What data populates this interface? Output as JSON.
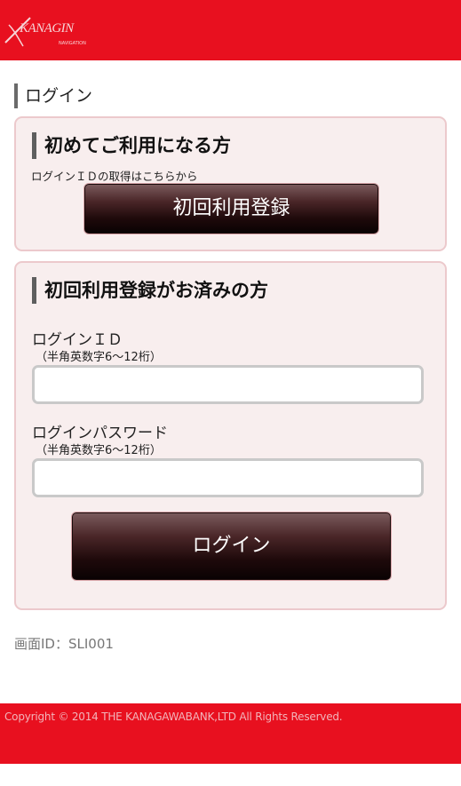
{
  "header": {
    "logo_text": "KANAGIN",
    "logo_subtext": "NAVIGATION",
    "background_color": "#e8101f"
  },
  "page_title": "ログイン",
  "first_time": {
    "heading": "初めてご利用になる方",
    "note": "ログインＩＤの取得はこちらから",
    "register_button": "初回利用登録"
  },
  "registered": {
    "heading": "初回利用登録がお済みの方",
    "login_id_label": "ログインＩＤ",
    "login_id_hint": "（半角英数字6～12桁）",
    "login_id_value": "",
    "password_label": "ログインパスワード",
    "password_hint": "（半角英数字6～12桁）",
    "password_value": "",
    "login_button": "ログイン"
  },
  "screen_id": "画面ID：SLI001",
  "footer": {
    "copyright": "Copyright © 2014 THE KANAGAWABANK,LTD All Rights Reserved."
  }
}
